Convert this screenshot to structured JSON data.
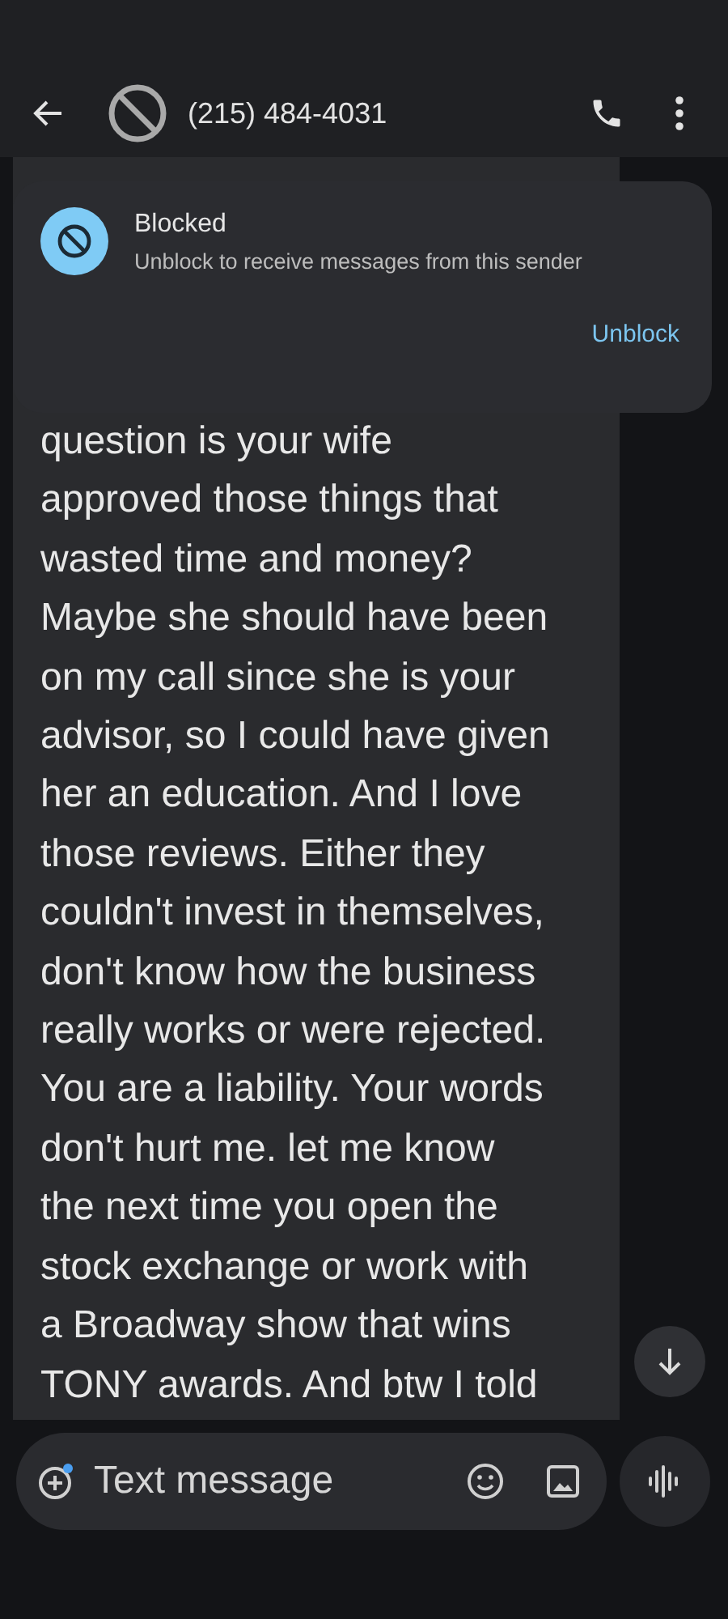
{
  "header": {
    "title": "(215) 484-4031"
  },
  "banner": {
    "title": "Blocked",
    "subtitle": "Unblock to receive messages from this sender",
    "action": "Unblock"
  },
  "message": {
    "lines": [
      "question is your wife",
      "approved those things that",
      "wasted time and money?",
      "Maybe she should have been",
      "on my call since she is your",
      "advisor, so I could have given",
      "her an education. And I love",
      "those reviews. Either they",
      "couldn't invest in themselves,",
      "don't know how the business",
      "really works or were rejected.",
      "You are a liability. Your words",
      "don't hurt me. let me know",
      "the next time you open the",
      "stock exchange or work with",
      "a Broadway show that wins",
      "TONY awards. And btw I told"
    ]
  },
  "composer": {
    "placeholder": "Text message"
  }
}
